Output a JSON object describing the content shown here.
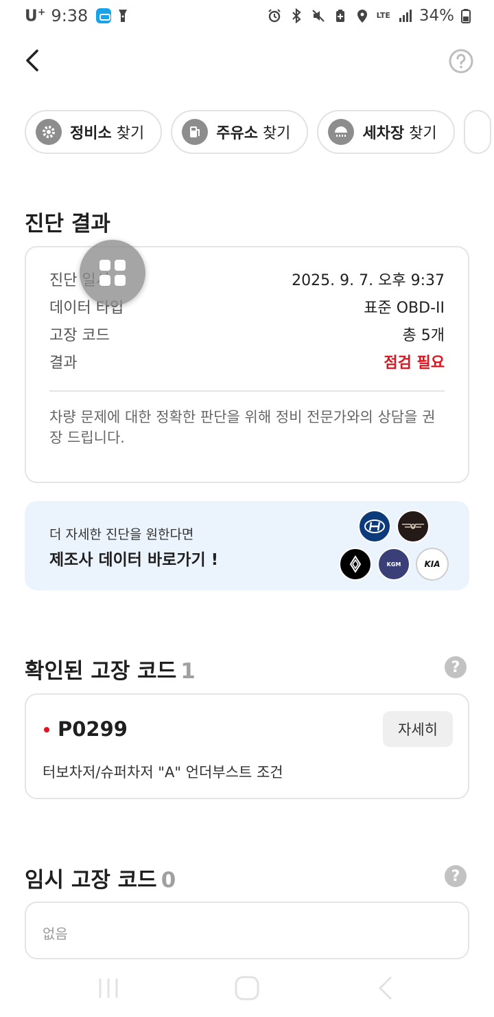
{
  "status_bar": {
    "carrier": "U",
    "carrier_sup": "+",
    "time": "9:38",
    "network": "LTE",
    "battery": "34%"
  },
  "icons": {
    "back": "chevron-left-icon",
    "help": "question-circle-icon"
  },
  "chips": [
    {
      "bold": "정비소",
      "label": " 찾기",
      "icon": "gear-icon"
    },
    {
      "bold": "주유소",
      "label": " 찾기",
      "icon": "fuel-pump-icon"
    },
    {
      "bold": "세차장",
      "label": " 찾기",
      "icon": "car-wash-icon"
    }
  ],
  "diagnosis": {
    "title": "진단 결과",
    "rows": [
      {
        "key": "진단 일시",
        "value": "2025. 9. 7. 오후 9:37"
      },
      {
        "key": "데이터 타입",
        "value": "표준 OBD-II"
      },
      {
        "key": "고장 코드",
        "value": "총 5개"
      },
      {
        "key": "결과",
        "value": "점검 필요"
      }
    ],
    "result_color": "#e0141e",
    "note": "차량 문제에 대한 정확한 판단을 위해 정비 전문가와의 상담을 권장 드립니다."
  },
  "banner": {
    "subtitle": "더 자세한 진단을 원한다면",
    "title": "제조사 데이터 바로가기 !",
    "background": "#ebf3fd",
    "logos": [
      "hyundai-logo",
      "genesis-logo",
      "renault-logo",
      "kgm-logo",
      "kia-logo"
    ],
    "kgm_text": "KGM",
    "kia_text": "KIA"
  },
  "confirmed_codes": {
    "title": "확인된 고장 코드",
    "count": "1",
    "items": [
      {
        "code": "P0299",
        "description": "터보차저/슈퍼차저 \"A\" 언더부스트 조건",
        "button": "자세히"
      }
    ]
  },
  "temporary_codes": {
    "title": "임시 고장 코드",
    "count": "0",
    "empty_text": "없음"
  }
}
